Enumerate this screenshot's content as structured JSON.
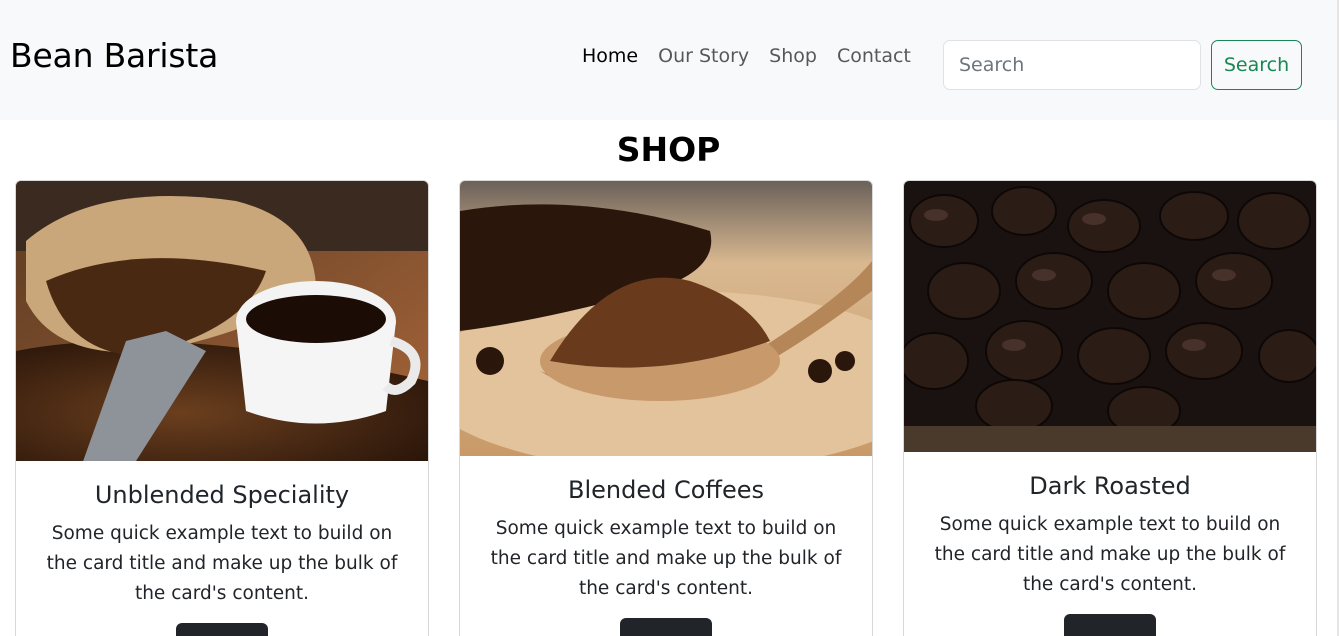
{
  "navbar": {
    "brand": "Bean Barista",
    "links": [
      {
        "label": "Home",
        "active": true
      },
      {
        "label": "Our Story",
        "active": false
      },
      {
        "label": "Shop",
        "active": false
      },
      {
        "label": "Contact",
        "active": false
      }
    ],
    "search_placeholder": "Search",
    "search_button": "Search"
  },
  "page": {
    "title": "SHOP"
  },
  "cards": [
    {
      "title": "Unblended Speciality",
      "text": "Some quick example text to build on the card title and make up the bulk of the card's content.",
      "image": "coffee-sack-and-cup-photo"
    },
    {
      "title": "Blended Coffees",
      "text": "Some quick example text to build on the card title and make up the bulk of the card's content.",
      "image": "ground-coffee-spoon-photo"
    },
    {
      "title": "Dark Roasted",
      "text": "Some quick example text to build on the card title and make up the bulk of the card's content.",
      "image": "dark-roasted-beans-photo"
    }
  ],
  "colors": {
    "navbar_bg": "#f8f9fa",
    "accent_green": "#198754",
    "button_dark": "#212529"
  }
}
